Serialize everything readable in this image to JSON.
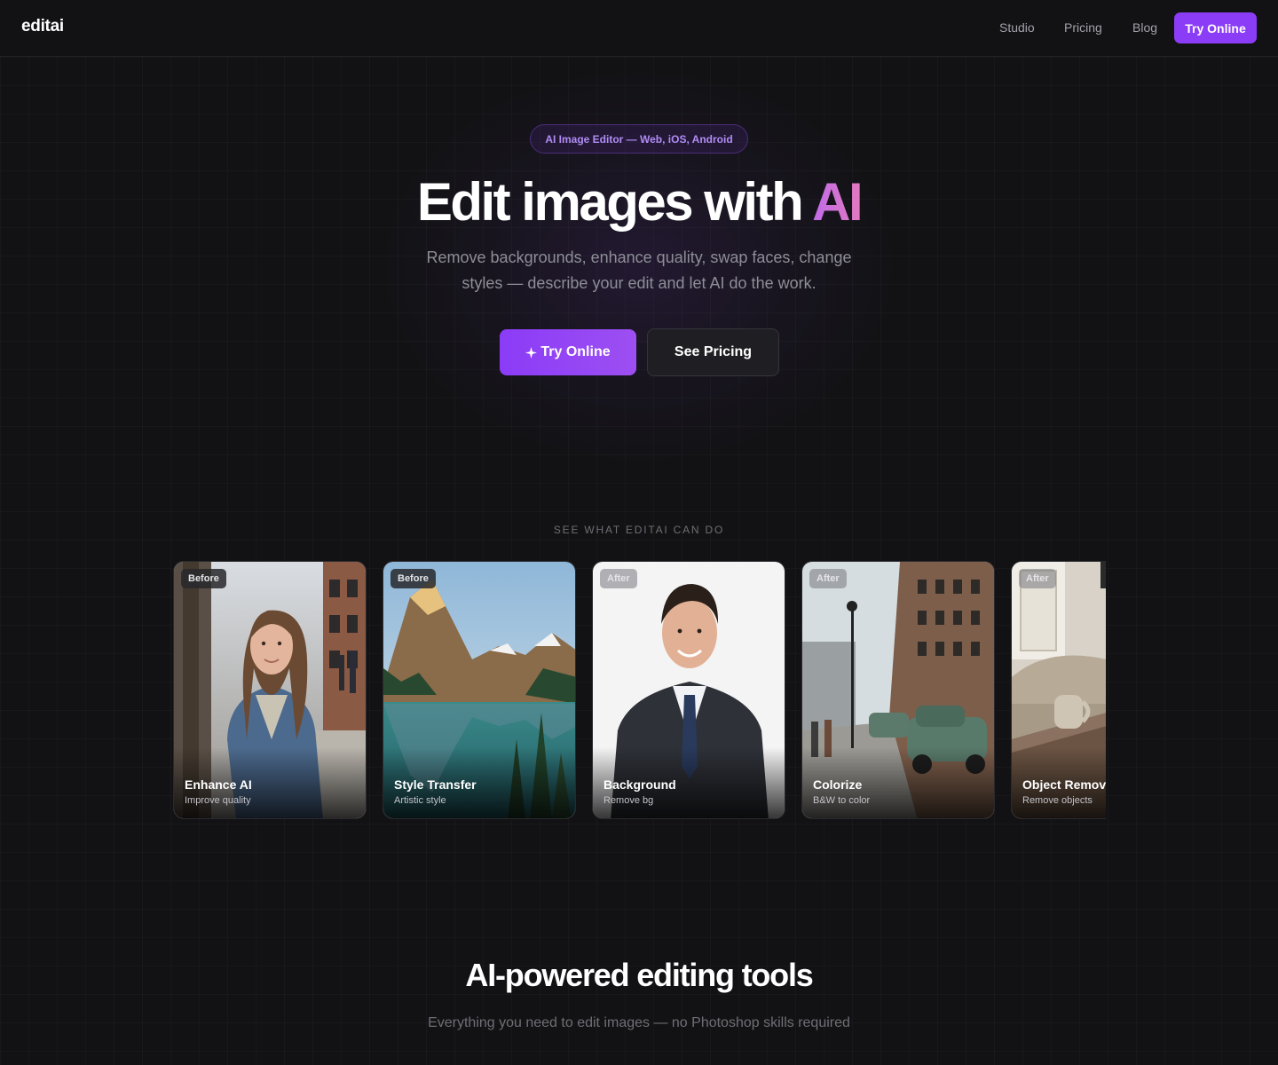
{
  "nav": {
    "logo": "editai",
    "links": [
      "Studio",
      "Pricing",
      "Blog"
    ],
    "cta": "Try Online"
  },
  "hero": {
    "badge": "AI Image Editor — Web, iOS, Android",
    "title_main": "Edit images with ",
    "title_accent": "AI",
    "subtitle": "Remove backgrounds, enhance quality, swap faces, change styles — describe your edit and let AI do the work.",
    "primary_button": "Try Online",
    "primary_icon": "sparkle-icon",
    "secondary_button": "See Pricing"
  },
  "showcase": {
    "eyebrow": "SEE WHAT EDITAI CAN DO",
    "cards": [
      {
        "tag": "Before",
        "title": "Enhance AI",
        "subtitle": "Improve quality"
      },
      {
        "tag": "Before",
        "title": "Style Transfer",
        "subtitle": "Artistic style"
      },
      {
        "tag": "After",
        "title": "Background",
        "subtitle": "Remove bg"
      },
      {
        "tag": "After",
        "title": "Colorize",
        "subtitle": "B&W to color"
      },
      {
        "tag": "After",
        "title": "Object Removal",
        "subtitle": "Remove objects"
      }
    ]
  },
  "tools": {
    "title": "AI-powered editing tools",
    "subtitle": "Everything you need to edit images — no Photoshop skills required"
  },
  "colors": {
    "accent": "#8b3cf7",
    "background": "#121214",
    "accent_gradient_start": "#c06be8",
    "accent_gradient_end": "#e27ac0"
  }
}
